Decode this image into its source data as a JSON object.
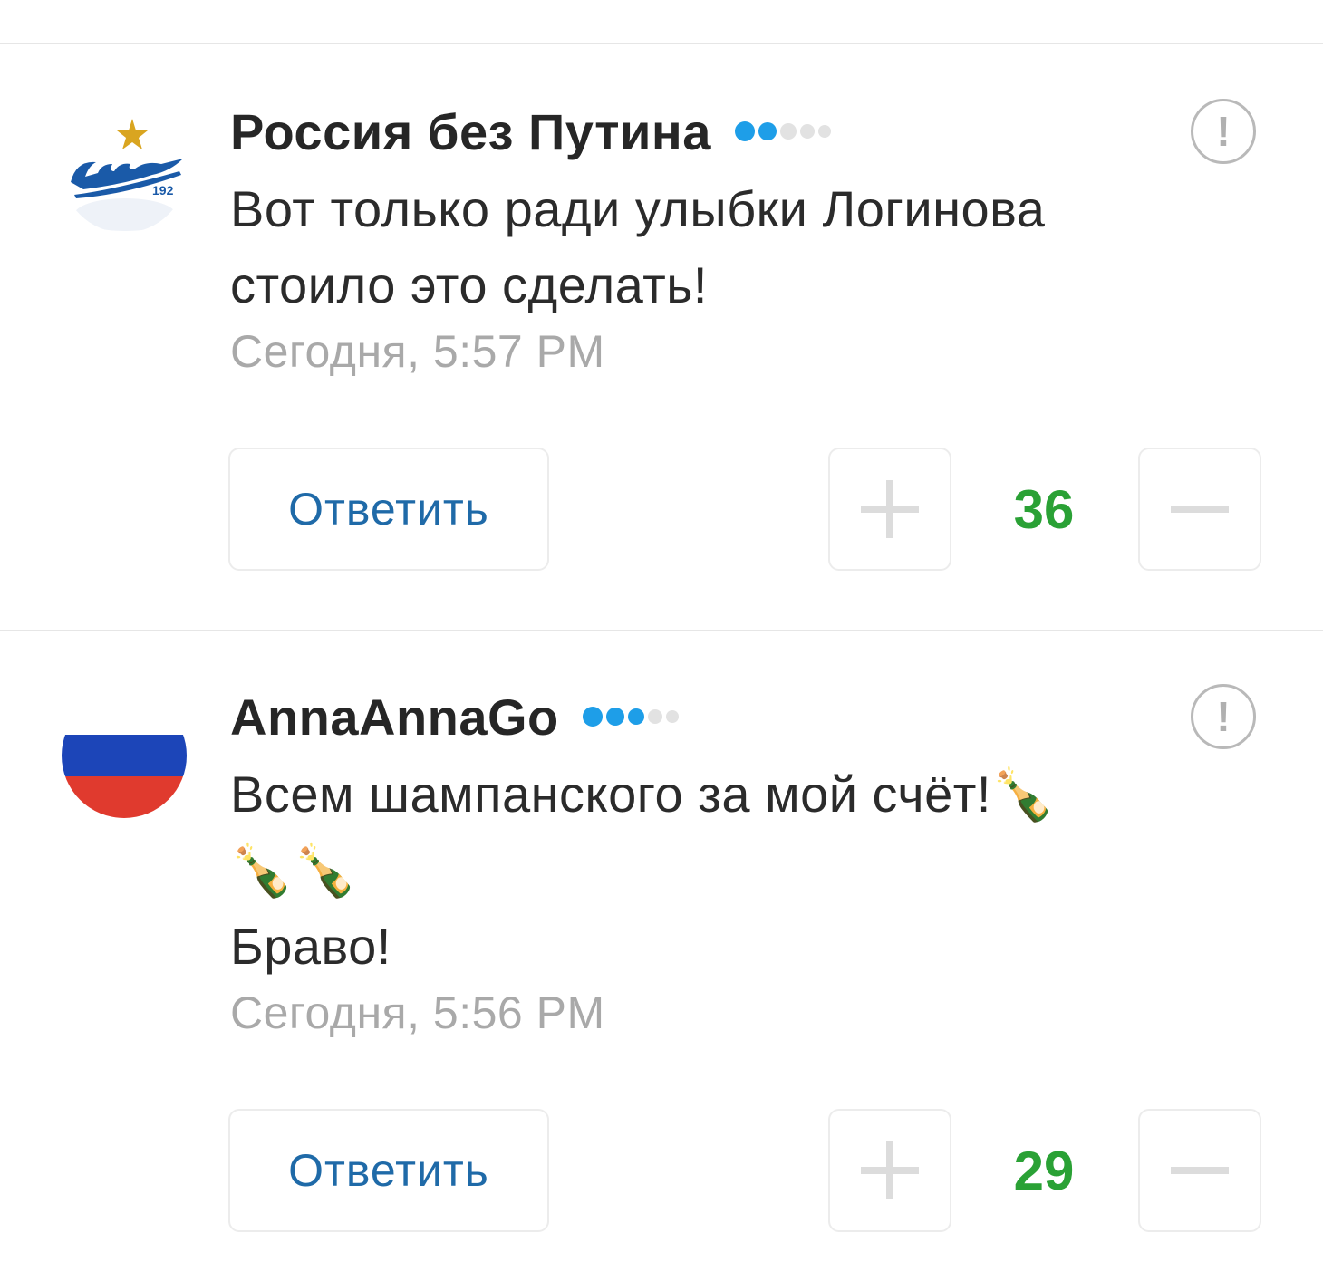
{
  "comments": [
    {
      "avatar": "zenit-logo",
      "author": "Россия без Путина",
      "rating_filled": 2,
      "rating_total": 5,
      "text_lines": [
        "Вот только ради улыбки Логинова",
        "стоило это сделать!"
      ],
      "time": "Сегодня, 5:57 PM",
      "reply_label": "Ответить",
      "score": "36",
      "report_symbol": "!"
    },
    {
      "avatar": "russian-flag",
      "author": "AnnaAnnaGo",
      "rating_filled": 3,
      "rating_total": 5,
      "text_lines": [
        "Всем шампанского за мой счёт!🍾",
        "🍾🍾",
        "Браво!"
      ],
      "time": "Сегодня, 5:56 PM",
      "reply_label": "Ответить",
      "score": "29",
      "report_symbol": "!"
    }
  ],
  "colors": {
    "rating_on": "#1e9ee8",
    "rating_off": "#e2e2e2",
    "score": "#2aa135",
    "reply": "#1f6aa8"
  },
  "icons": {
    "plus": "plus-icon",
    "minus": "minus-icon",
    "report": "report-icon"
  }
}
